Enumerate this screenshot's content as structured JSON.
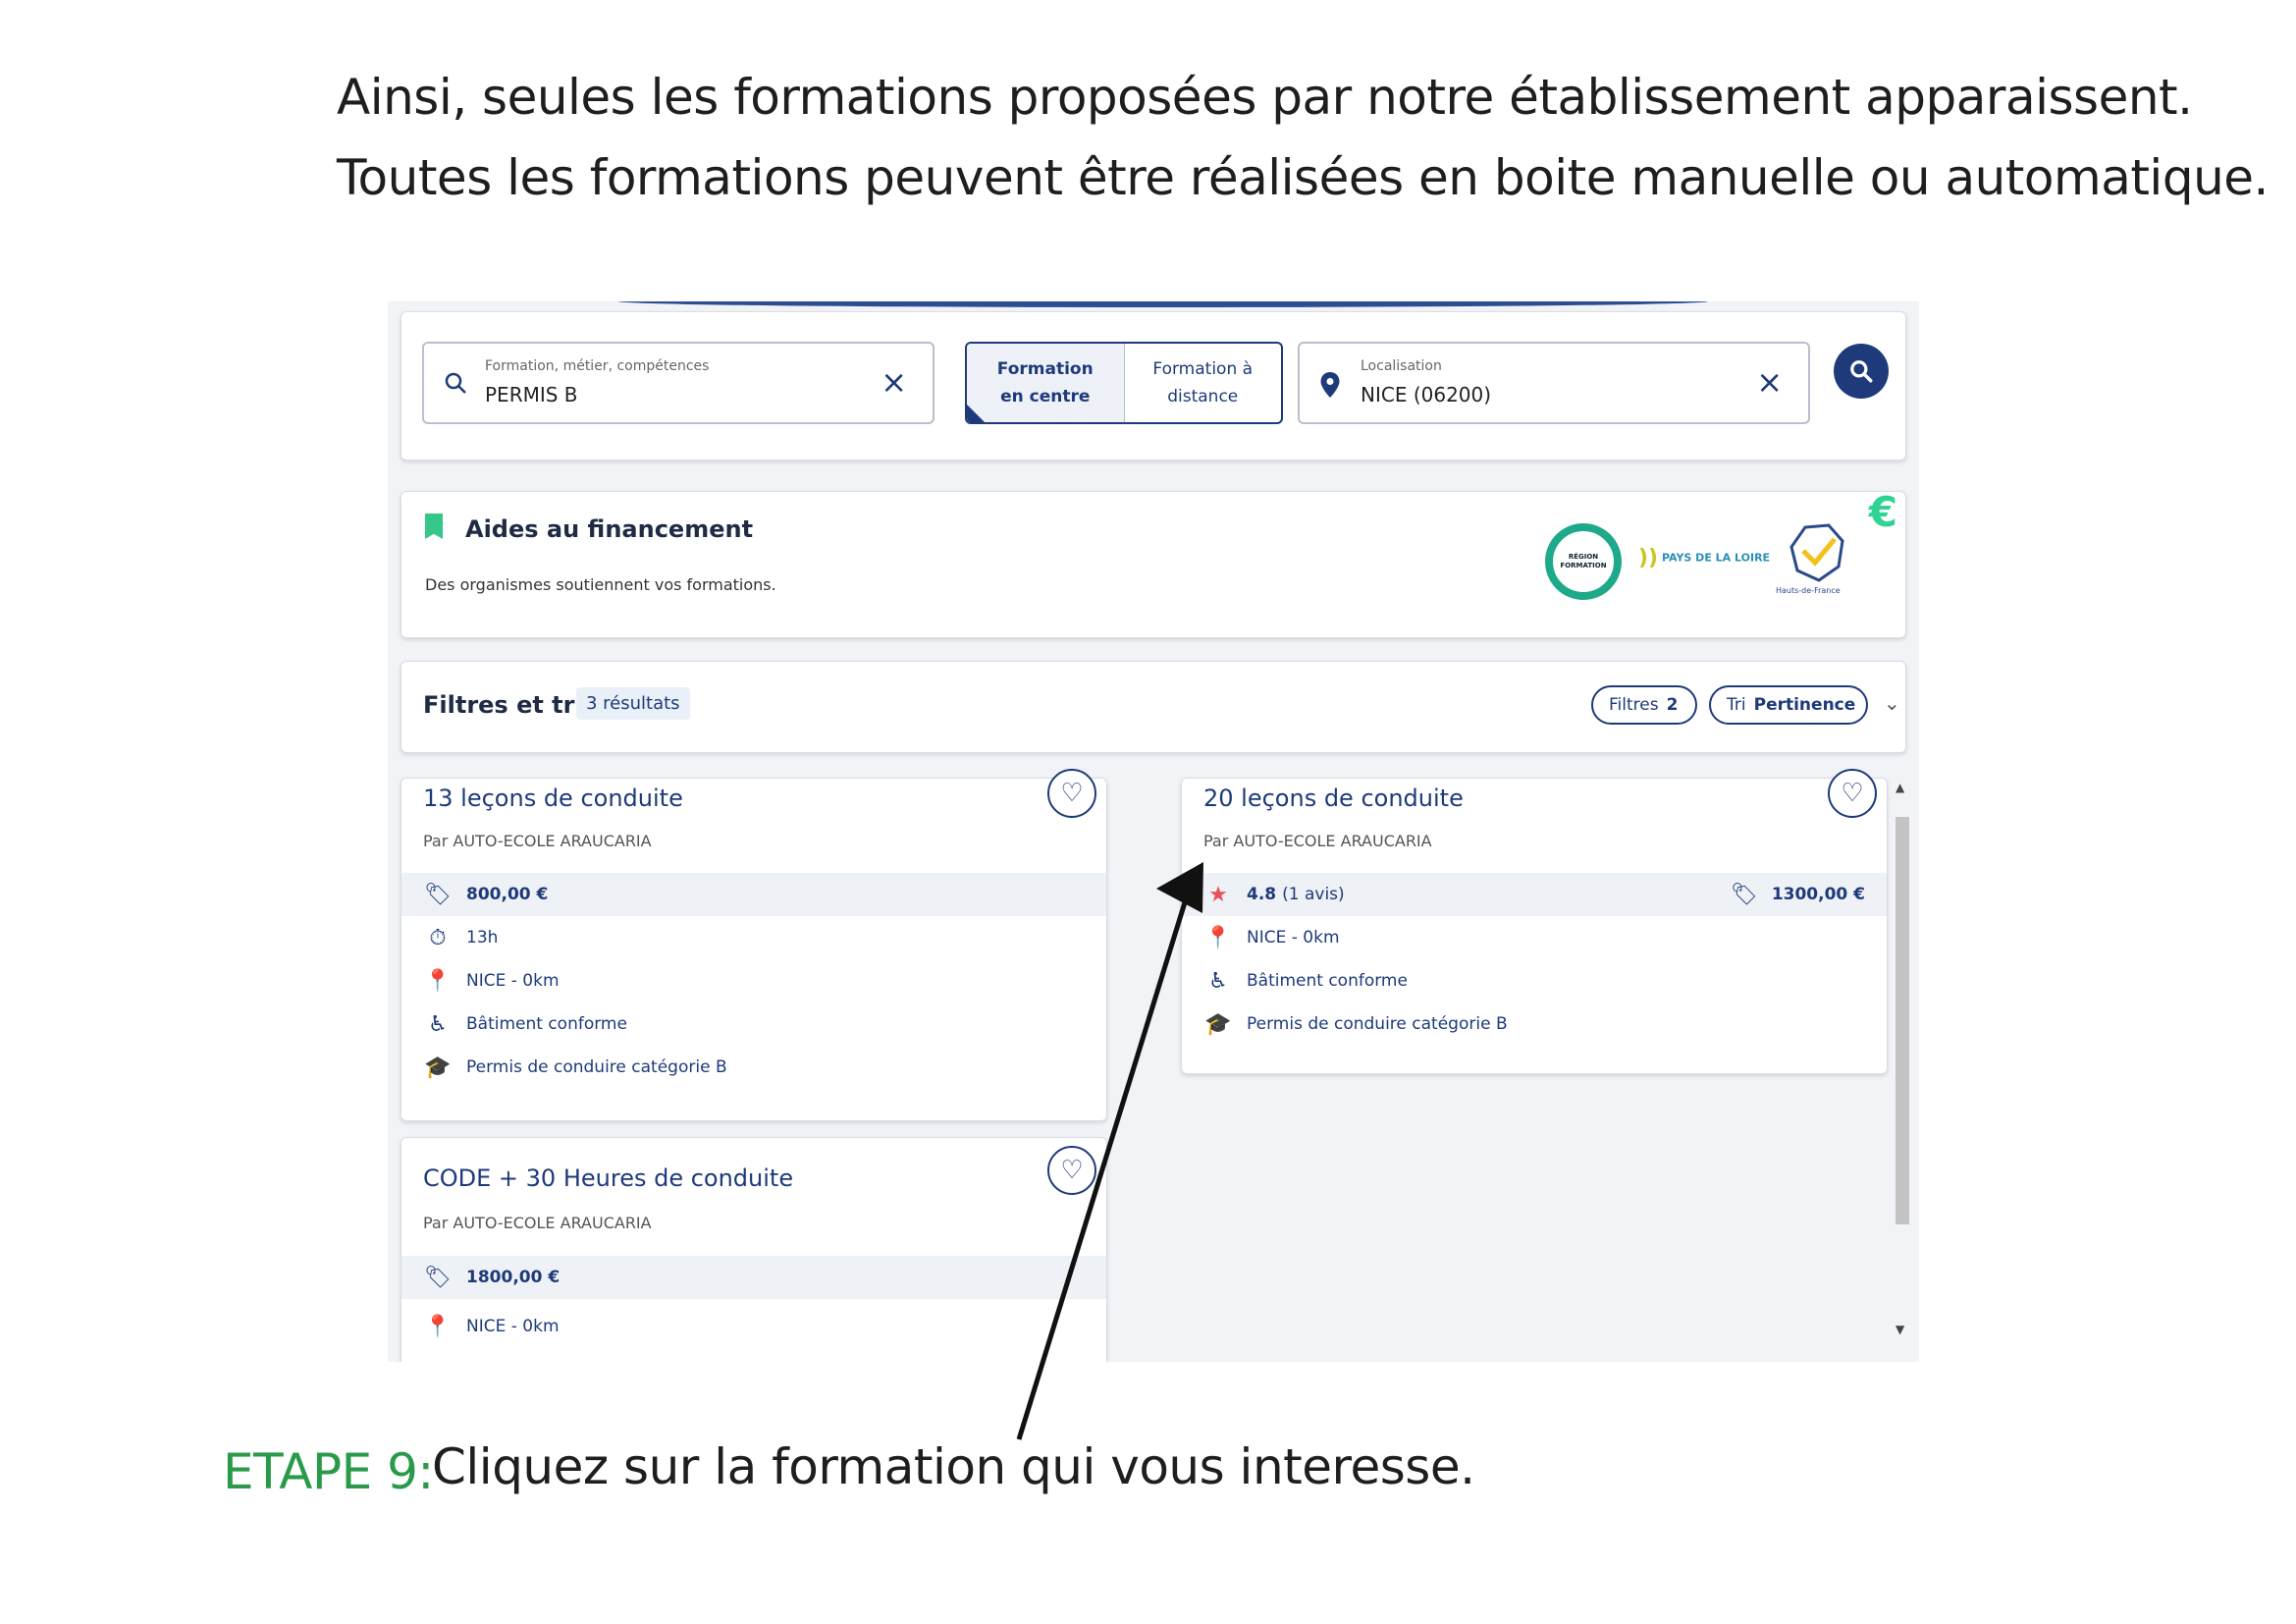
{
  "intro": {
    "line1": "Ainsi, seules les formations proposées par notre établissement apparaissent.",
    "line2": "Toutes les formations peuvent être réalisées en boite manuelle ou automatique."
  },
  "search": {
    "formation_label": "Formation, métier, compétences",
    "formation_value": "PERMIS B",
    "toggle_centre_1": "Formation",
    "toggle_centre_2": "en centre",
    "toggle_distance_1": "Formation à",
    "toggle_distance_2": "distance",
    "location_label": "Localisation",
    "location_value": "NICE (06200)",
    "clear_glyph": "×"
  },
  "aides": {
    "title": "Aides au financement",
    "subtitle": "Des organismes soutiennent vos formations.",
    "logo_region": "RÉGION FORMATION",
    "logo_pdl": "PAYS DE LA LOIRE",
    "logo_hdf": "Hauts-de-France",
    "euro": "€"
  },
  "filters": {
    "title": "Filtres et tri",
    "results": "3 résultats",
    "filtres_label": "Filtres",
    "filtres_count": "2",
    "tri_label": "Tri",
    "tri_value": "Pertinence"
  },
  "results": [
    {
      "title": "13 leçons de conduite",
      "by": "Par AUTO-ECOLE ARAUCARIA",
      "price": "800,00 €",
      "duration": "13h",
      "location": "NICE - 0km",
      "building": "Bâtiment conforme",
      "certification": "Permis de conduire catégorie B"
    },
    {
      "title": "20 leçons de conduite",
      "by": "Par AUTO-ECOLE ARAUCARIA",
      "rating": "4.8",
      "reviews": "(1 avis)",
      "price": "1300,00 €",
      "location": "NICE - 0km",
      "building": "Bâtiment conforme",
      "certification": "Permis de conduire catégorie B"
    },
    {
      "title": "CODE + 30 Heures de conduite",
      "by": "Par AUTO-ECOLE ARAUCARIA",
      "price": "1800,00 €",
      "location": "NICE - 0km"
    }
  ],
  "step": {
    "label": "ETAPE 9:",
    "text": "Cliquez sur la formation qui vous interesse."
  },
  "colors": {
    "brand": "#1f3a7a",
    "step_green": "#2a9a4a",
    "aides_green": "#36c68a"
  }
}
